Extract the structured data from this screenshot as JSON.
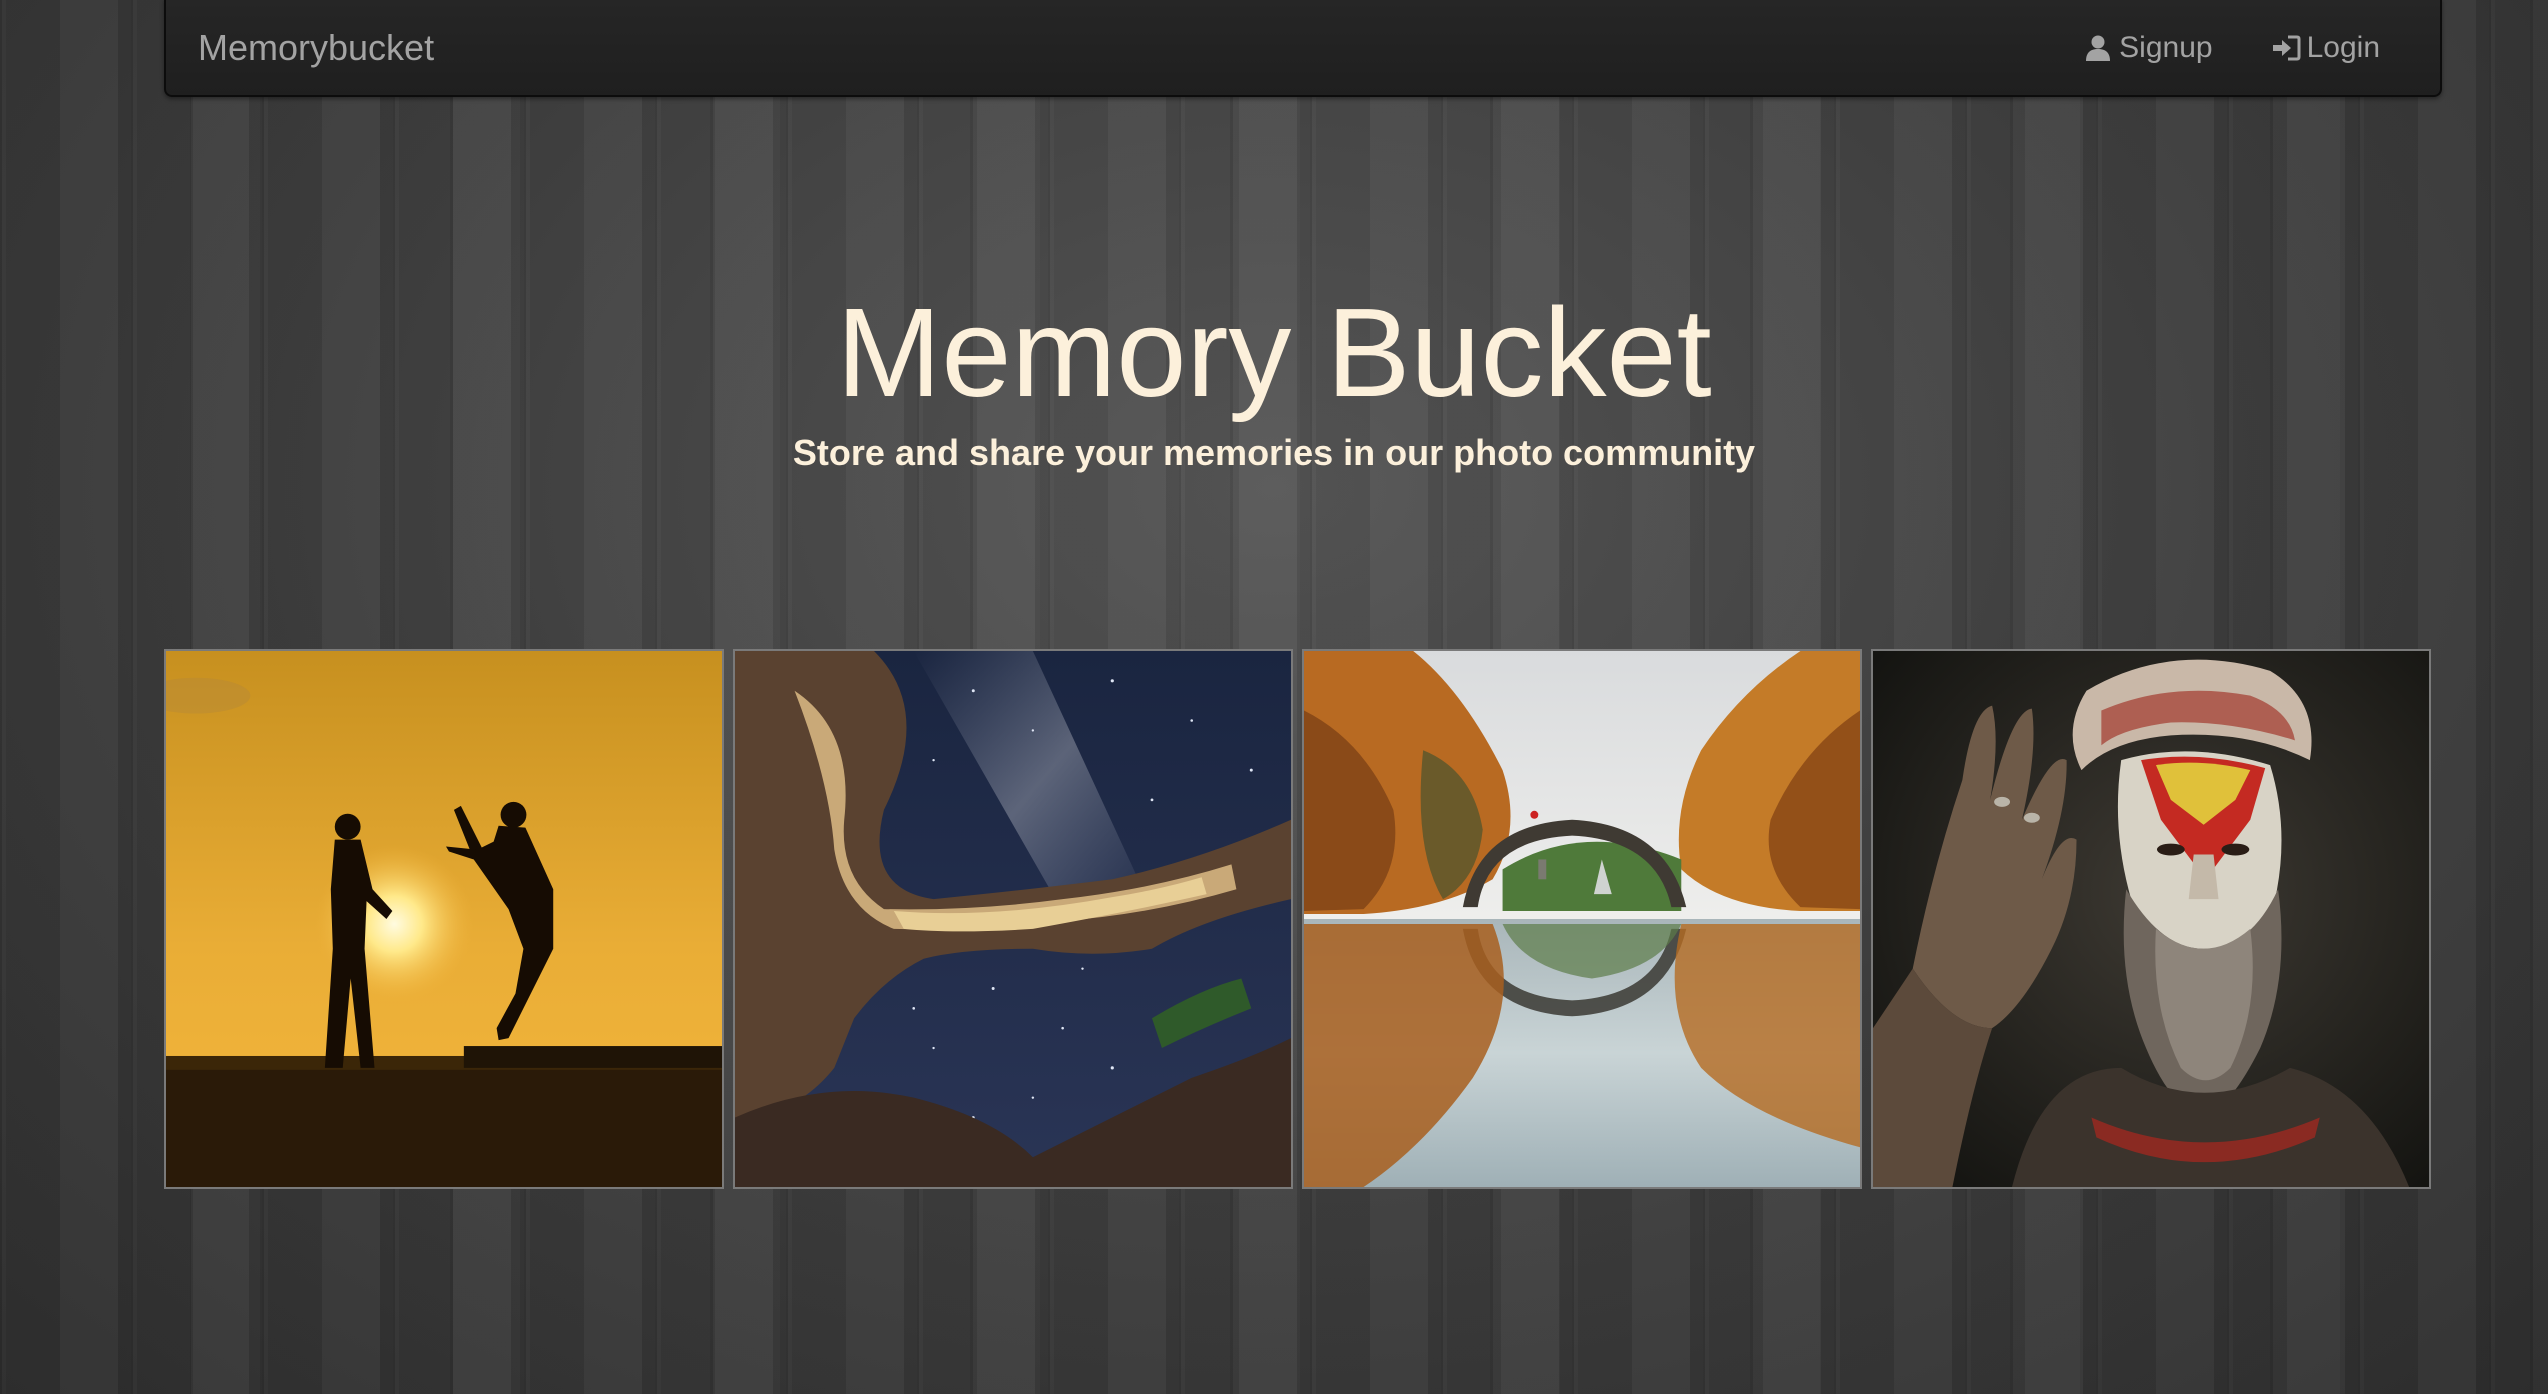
{
  "navbar": {
    "brand": "Memorybucket",
    "links": [
      {
        "label": "Signup",
        "icon": "user-icon"
      },
      {
        "label": "Login",
        "icon": "login-icon"
      }
    ]
  },
  "hero": {
    "title": "Memory Bucket",
    "subtitle": "Store and share your memories in our photo community"
  },
  "gallery": {
    "photos": [
      {
        "subject": "silhouettes-sunset-photo"
      },
      {
        "subject": "starry-sky-rock-arch-photo"
      },
      {
        "subject": "autumn-bridge-reflection-photo"
      },
      {
        "subject": "painted-face-portrait-photo"
      }
    ]
  },
  "colors": {
    "title_text": "#fcf0db",
    "nav_text": "#a3a3a3",
    "navbar_bg": "#222222"
  }
}
